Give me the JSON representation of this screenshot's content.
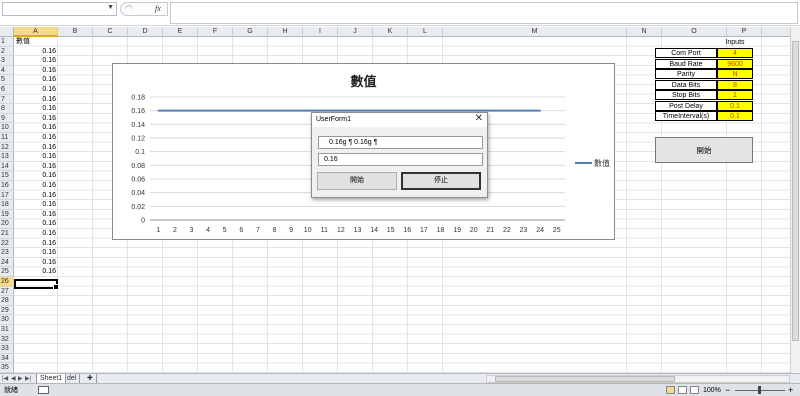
{
  "formula_bar": {
    "name_box": "",
    "fx_label": "fx",
    "formula": ""
  },
  "columns": [
    "A",
    "B",
    "C",
    "D",
    "E",
    "F",
    "G",
    "H",
    "I",
    "J",
    "K",
    "L",
    "M",
    "N",
    "O",
    "P"
  ],
  "selected_column": "A",
  "rows": [
    "1",
    "2",
    "3",
    "4",
    "5",
    "6",
    "7",
    "8",
    "9",
    "10",
    "11",
    "12",
    "13",
    "14",
    "15",
    "16",
    "17",
    "18",
    "19",
    "20",
    "21",
    "22",
    "23",
    "24",
    "25",
    "26",
    "27",
    "28",
    "29",
    "30",
    "31",
    "32",
    "33",
    "34",
    "35"
  ],
  "selected_row": "26",
  "col_a_header": "數值",
  "col_a_values": [
    "0.16",
    "0.16",
    "0.16",
    "0.16",
    "0.16",
    "0.16",
    "0.16",
    "0.16",
    "0.16",
    "0.16",
    "0.16",
    "0.16",
    "0.16",
    "0.16",
    "0.16",
    "0.16",
    "0.16",
    "0.16",
    "0.16",
    "0.16",
    "0.16",
    "0.16",
    "0.16",
    "0.16"
  ],
  "inputs_table": {
    "title": "Inputs",
    "rows": [
      {
        "label": "Com Port",
        "value": "4"
      },
      {
        "label": "Baud Rate",
        "value": "9600"
      },
      {
        "label": "Parity",
        "value": "N"
      },
      {
        "label": "Data Bits",
        "value": "8"
      },
      {
        "label": "Stop Bits",
        "value": "1"
      },
      {
        "label": "Post Delay",
        "value": "0.1"
      },
      {
        "label": "TimeInterval(s)",
        "value": "0.1"
      }
    ],
    "start_button": "開始"
  },
  "userform": {
    "title": "UserForm1",
    "textbox1": "0.16g ¶  0.16g ¶",
    "textbox2": "0.16",
    "start_button": "開始",
    "stop_button": "停止"
  },
  "sheet_tabs": [
    "Sheet1",
    "del"
  ],
  "status": {
    "ready": "就緒",
    "zoom": "100%"
  },
  "chart_data": {
    "type": "line",
    "title": "數值",
    "x": [
      1,
      2,
      3,
      4,
      5,
      6,
      7,
      8,
      9,
      10,
      11,
      12,
      13,
      14,
      15,
      16,
      17,
      18,
      19,
      20,
      21,
      22,
      23,
      24
    ],
    "x_ticks": [
      "1",
      "2",
      "3",
      "4",
      "5",
      "6",
      "7",
      "8",
      "9",
      "10",
      "11",
      "12",
      "13",
      "14",
      "15",
      "16",
      "17",
      "18",
      "19",
      "20",
      "21",
      "22",
      "23",
      "24",
      "25"
    ],
    "series": [
      {
        "name": "數值",
        "values": [
          0.16,
          0.16,
          0.16,
          0.16,
          0.16,
          0.16,
          0.16,
          0.16,
          0.16,
          0.16,
          0.16,
          0.16,
          0.16,
          0.16,
          0.16,
          0.16,
          0.16,
          0.16,
          0.16,
          0.16,
          0.16,
          0.16,
          0.16,
          0.16
        ],
        "color": "#4f81bd"
      }
    ],
    "y_ticks": [
      "0",
      "0.02",
      "0.04",
      "0.06",
      "0.08",
      "0.1",
      "0.12",
      "0.14",
      "0.16",
      "0.18"
    ],
    "ylim": [
      0,
      0.18
    ],
    "grid": true,
    "legend": "right"
  }
}
